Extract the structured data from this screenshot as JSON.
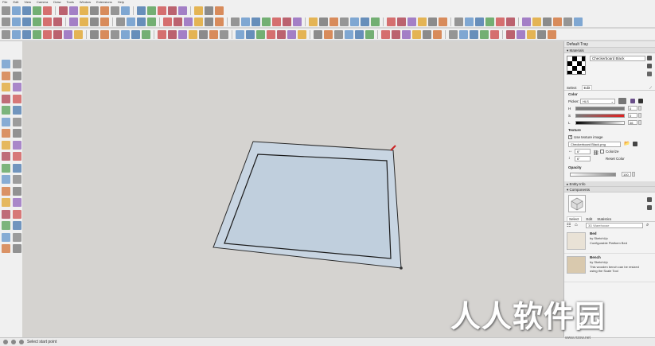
{
  "menu": [
    "File",
    "Edit",
    "View",
    "Camera",
    "Draw",
    "Tools",
    "Window",
    "Extensions",
    "Help"
  ],
  "status": {
    "text": "Select start point"
  },
  "tray": {
    "title": "Default Tray",
    "materials": {
      "header": "Materials",
      "name": "Checkerboard Black",
      "tabs": [
        "Select",
        "Edit"
      ],
      "color_label": "Color",
      "picker_label": "Picker:",
      "picker_value": "HLS",
      "h_label": "H",
      "h_value": "0",
      "s_label": "S",
      "s_value": "0",
      "l_label": "L",
      "l_value": "46",
      "texture_label": "Texture",
      "use_texture": "Use texture image",
      "texture_file": "Checkerboard Black.png",
      "width_value": "6\"",
      "height_value": "6\"",
      "colorize_label": "Colorize",
      "reset_color_label": "Reset Color",
      "opacity_label": "Opacity",
      "opacity_value": "100"
    },
    "entity_info": {
      "header": "Entity Info"
    },
    "components": {
      "header": "Components",
      "tabs": [
        "Select",
        "Edit",
        "Statistics"
      ],
      "search_placeholder": "3D Warehouse",
      "items": [
        {
          "title": "Bed",
          "by": "by SketchUp",
          "desc": "Configurable Platform Bed"
        },
        {
          "title": "Bench",
          "by": "by SketchUp",
          "desc": "This wooden bench can be resized using the Scale Tool"
        }
      ]
    }
  },
  "watermark": {
    "text": "人人软件园",
    "url": "www.rrzxw.net"
  },
  "colors": {
    "face": "#c5d2df",
    "edge": "#2a2a2a",
    "viewport": "#d5d3d0",
    "accent_red": "#e02020"
  }
}
